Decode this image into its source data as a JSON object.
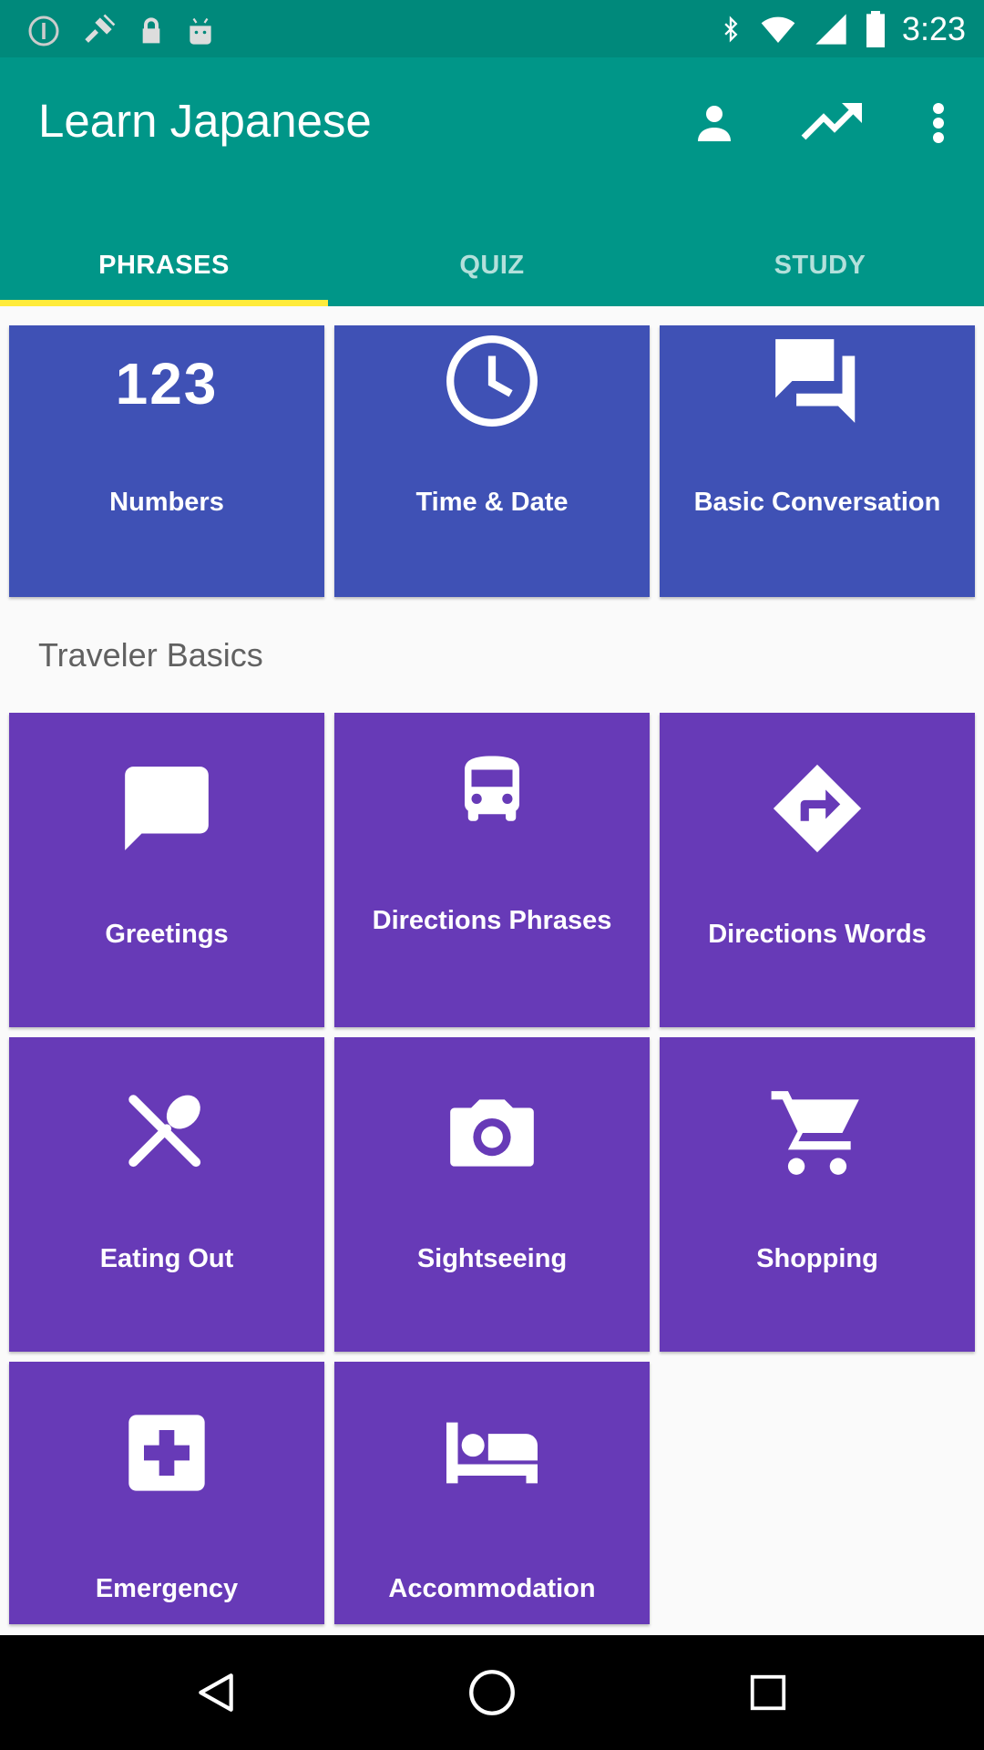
{
  "status_bar": {
    "time": "3:23",
    "left_icons": [
      "alert-circle-icon",
      "fake-gps-icon",
      "lock-icon",
      "android-icon"
    ],
    "right_icons": [
      "bluetooth-icon",
      "wifi-icon",
      "signal-icon",
      "battery-icon"
    ]
  },
  "app_bar": {
    "title": "Learn Japanese",
    "actions": [
      "account-icon",
      "trending-up-icon",
      "more-vert-icon"
    ],
    "color": "#009688"
  },
  "tabs": [
    {
      "label": "PHRASES",
      "active": true
    },
    {
      "label": "QUIZ",
      "active": false
    },
    {
      "label": "STUDY",
      "active": false
    }
  ],
  "top_categories": [
    {
      "label": "Numbers",
      "icon": "numbers-123-icon"
    },
    {
      "label": "Time & Date",
      "icon": "clock-icon"
    },
    {
      "label": "Basic Conversation",
      "icon": "chat-bubbles-icon"
    }
  ],
  "section": {
    "title": "Traveler Basics"
  },
  "traveler_categories": [
    {
      "label": "Greetings",
      "icon": "message-icon"
    },
    {
      "label": "Directions Phrases",
      "icon": "bus-icon"
    },
    {
      "label": "Directions Words",
      "icon": "directions-sign-icon"
    },
    {
      "label": "Eating Out",
      "icon": "utensils-icon"
    },
    {
      "label": "Sightseeing",
      "icon": "camera-icon"
    },
    {
      "label": "Shopping",
      "icon": "cart-icon"
    },
    {
      "label": "Emergency",
      "icon": "first-aid-icon"
    },
    {
      "label": "Accommodation",
      "icon": "bed-icon"
    }
  ],
  "colors": {
    "accent_indicator": "#ffeb3b",
    "top_tile": "#3f51b5",
    "travel_tile": "#673ab7",
    "status_bar": "#00897b"
  },
  "nav_bar": [
    "back-icon",
    "home-icon",
    "recents-icon"
  ]
}
